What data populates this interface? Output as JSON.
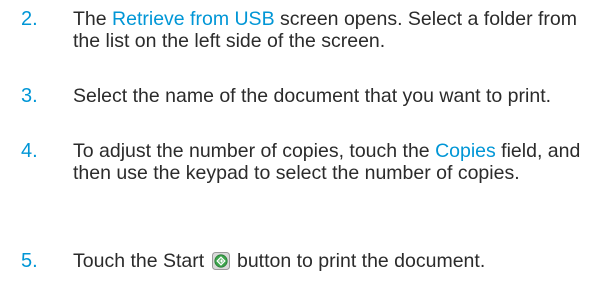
{
  "steps": [
    {
      "number": "2.",
      "before": "The ",
      "term": "Retrieve from USB",
      "after": " screen opens. Select a folder from the list on the left side of the screen."
    },
    {
      "number": "3.",
      "text": "Select the name of the document that you want to print."
    },
    {
      "number": "4.",
      "before": "To adjust the number of copies, touch the ",
      "term": "Copies",
      "after": " field, and then use the keypad to select the number of copies."
    },
    {
      "number": "5.",
      "before": "Touch the Start ",
      "icon": "start-button-icon",
      "after": " button to print the document."
    }
  ],
  "colors": {
    "step_number": "#0096d6",
    "ui_term": "#0096d6",
    "body_text": "#2b2b2b",
    "start_icon_green": "#3aa34a"
  }
}
